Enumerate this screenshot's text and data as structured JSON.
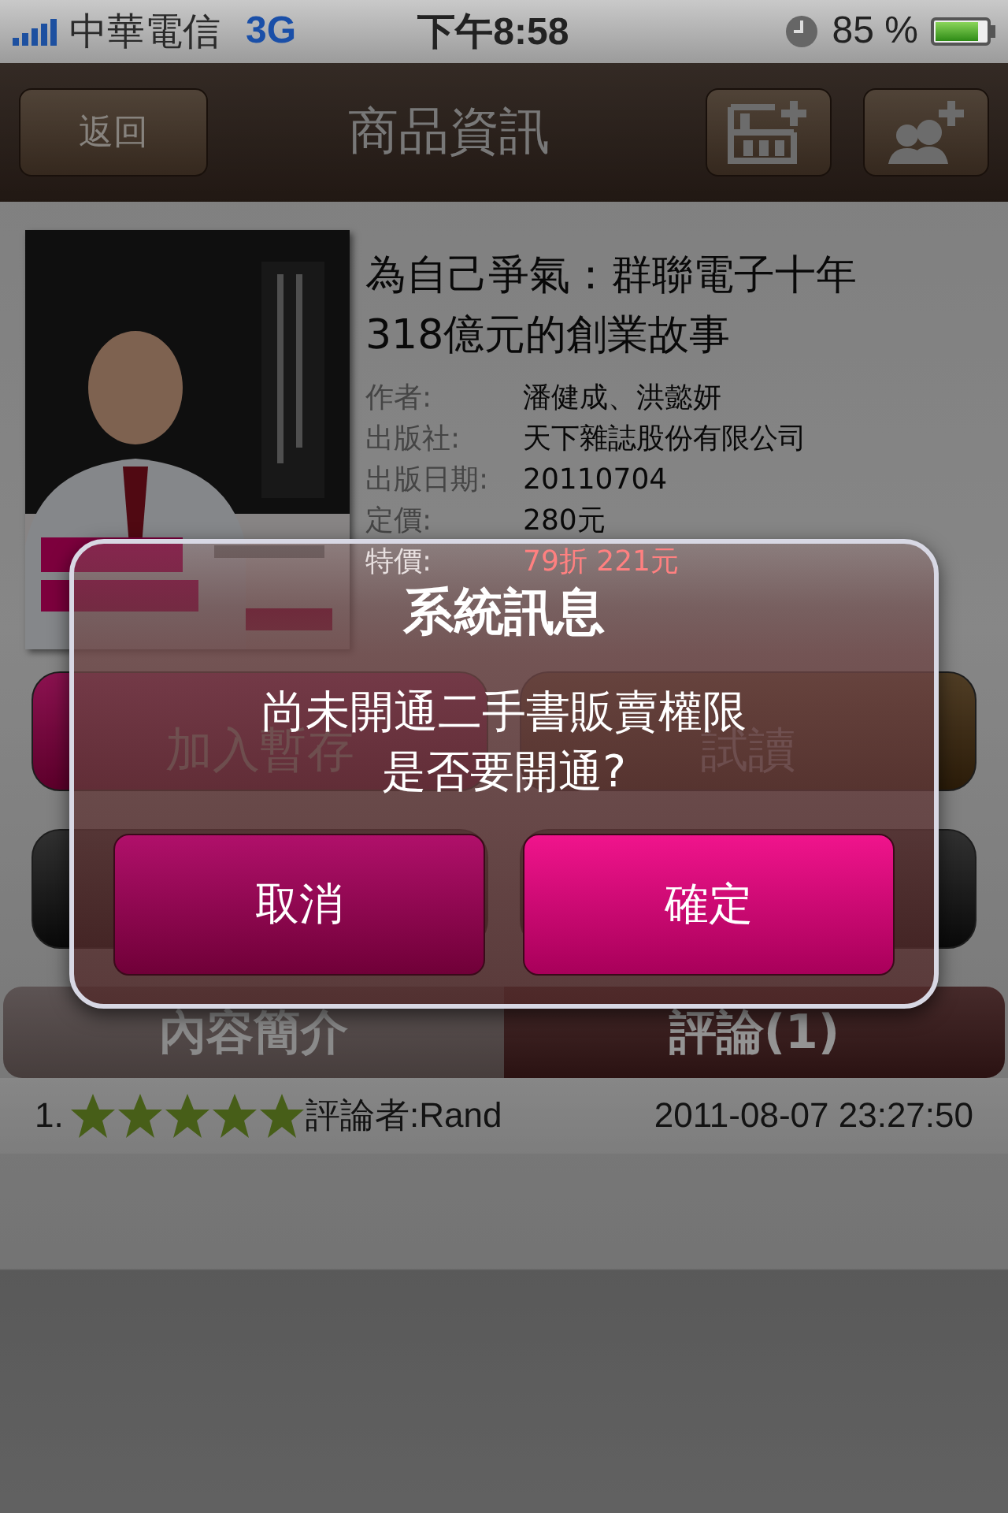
{
  "status_bar": {
    "carrier": "中華電信",
    "network": "3G",
    "time": "下午8:58",
    "battery": "85 %"
  },
  "nav_bar": {
    "back": "返回",
    "title": "商品資訊"
  },
  "book": {
    "title": "為自己爭氣：群聯電子十年318億元的創業故事",
    "details": [
      {
        "label": "作者:",
        "value": "潘健成、洪懿妍",
        "kind": "plain"
      },
      {
        "label": "出版社:",
        "value": "天下雜誌股份有限公司",
        "kind": "plain"
      },
      {
        "label": "出版日期:",
        "value": "20110704",
        "kind": "plain"
      },
      {
        "label": "定價:",
        "value": "280元",
        "kind": "plain"
      },
      {
        "label": "特價:",
        "value": "79折 221元",
        "kind": "sale"
      }
    ]
  },
  "actions": [
    {
      "label": "加入暫存",
      "kind": "pink"
    },
    {
      "label": "試讀",
      "kind": "brown"
    },
    {
      "kind": "black"
    },
    {
      "kind": "black"
    }
  ],
  "tabs": [
    {
      "label": "內容簡介",
      "selected": false
    },
    {
      "label": "評論(1)",
      "selected": true
    }
  ],
  "reviews": [
    {
      "index": "1.",
      "stars": 5,
      "reviewer": "評論者:Rand",
      "date": "2011-08-07 23:27:50"
    }
  ],
  "dialog": {
    "title": "系統訊息",
    "message": [
      "尚未開通二手書販賣權限",
      "是否要開通?"
    ],
    "buttons": [
      {
        "label": "取消",
        "kind": "cancel"
      },
      {
        "label": "確定",
        "kind": "confirm"
      }
    ]
  }
}
